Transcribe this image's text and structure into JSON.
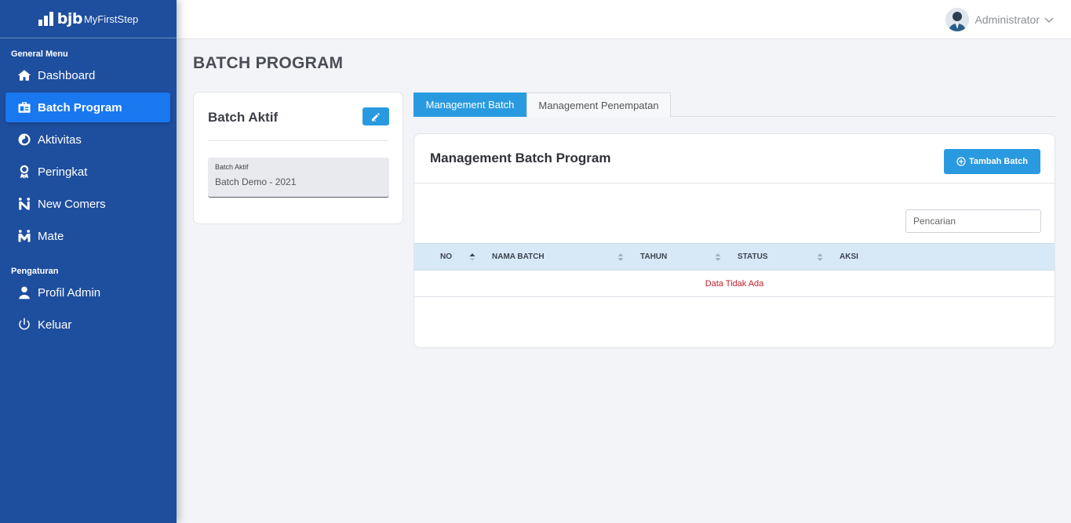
{
  "brand": {
    "mark": "bjb",
    "name": "MyFirstStep"
  },
  "sidebar": {
    "sections": [
      {
        "title": "General Menu"
      },
      {
        "title": "Pengaturan"
      }
    ],
    "general_items": [
      {
        "label": "Dashboard",
        "icon": "home-icon"
      },
      {
        "label": "Batch Program",
        "icon": "batch-icon",
        "active": true
      },
      {
        "label": "Aktivitas",
        "icon": "activity-icon"
      },
      {
        "label": "Peringkat",
        "icon": "ranking-icon"
      },
      {
        "label": "New Comers",
        "icon": "newcomers-icon"
      },
      {
        "label": "Mate",
        "icon": "mate-icon"
      }
    ],
    "settings_items": [
      {
        "label": "Profil Admin",
        "icon": "user-icon"
      },
      {
        "label": "Keluar",
        "icon": "power-icon"
      }
    ]
  },
  "header": {
    "user_name": "Administrator"
  },
  "page": {
    "title": "BATCH PROGRAM"
  },
  "active_batch_card": {
    "title": "Batch Aktif",
    "field_label": "Batch Aktif",
    "field_value": "Batch Demo - 2021"
  },
  "tabs": [
    {
      "label": "Management Batch",
      "active": true
    },
    {
      "label": "Management Penempatan",
      "active": false
    }
  ],
  "management": {
    "title": "Management Batch Program",
    "add_button": "Tambah Batch",
    "search_placeholder": "Pencarian",
    "columns": [
      "NO",
      "NAMA BATCH",
      "TAHUN",
      "STATUS",
      "AKSI"
    ],
    "empty_text": "Data Tidak Ada"
  },
  "colors": {
    "sidebar": "#1e4e9e",
    "active_item": "#1977f0",
    "accent": "#2a9ae0",
    "table_header": "#d7e9f6",
    "empty_text": "#c0202a"
  }
}
